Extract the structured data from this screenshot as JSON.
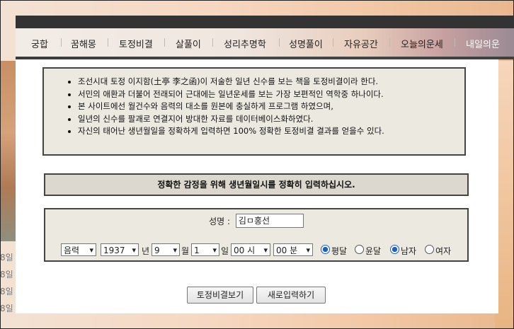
{
  "menu": {
    "items": [
      "궁합",
      "꿈해몽",
      "토정비결",
      "살풀이",
      "성리추명학",
      "성명풀이",
      "자유공간",
      "오늘의운세",
      "내일의운"
    ]
  },
  "side_dates": [
    "8일",
    "8일",
    "8일",
    "8일"
  ],
  "intro": {
    "lines": [
      "조선시대 토정 이지함(土亭 李之函)이 저술한 일년 신수를 보는 책을 토정비결이라 한다.",
      "서민의 애환과 더불어 전래되어 근대에는 일년운세를 보는 가장 보편적인 역학중 하나이다.",
      "본 사이트에선 월건수와 음력의 대소를 원본에 충실하게 프로그램 하였으며,",
      "일년의 신수를 팔괘로 연결지어 방대한 자료를 데이터베이스화하였다.",
      "자신의 태어난 생년월일을 정확하게 입력하면 100% 정확한 토정비결 결과를 얻을수 있다."
    ]
  },
  "notice": "정확한 감정을 위해 생년월일시를 정확히 입력하십시오.",
  "form": {
    "name_label": "성명 :",
    "name_value": "김ㅁ홍선",
    "calendar": "음력",
    "year": "1937",
    "year_unit": "년",
    "month": "9",
    "month_unit": "월",
    "day": "1",
    "day_unit": "일",
    "hour": "00 시",
    "minute": "00 분",
    "leap_normal": "평달",
    "leap_yun": "윤달",
    "male": "남자",
    "female": "여자"
  },
  "buttons": {
    "submit": "토정비결보기",
    "reset": "새로입력하기"
  },
  "state": {
    "leap_selected": "평달",
    "gender_selected": "남자"
  }
}
